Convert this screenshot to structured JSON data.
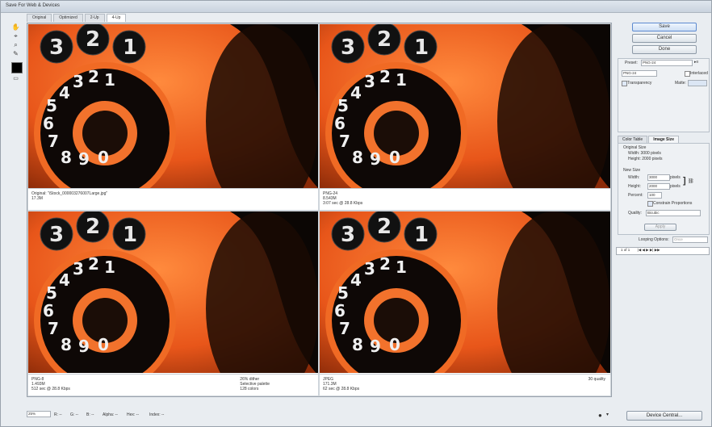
{
  "window": {
    "title": "Save For Web & Devices"
  },
  "tabs": [
    "Original",
    "Optimized",
    "2-Up",
    "4-Up"
  ],
  "active_tab": "4-Up",
  "tools": [
    {
      "name": "hand-tool-icon",
      "glyph": "✋"
    },
    {
      "name": "slice-select-tool-icon",
      "glyph": "⌖"
    },
    {
      "name": "zoom-tool-icon",
      "glyph": "⌕"
    },
    {
      "name": "eyedropper-tool-icon",
      "glyph": "✎"
    }
  ],
  "eyedropper_color": "#000000",
  "panes": [
    {
      "lines_left": [
        "Original: \"iStock_000003276007Large.jpg\"",
        "17.3M"
      ],
      "lines_right": [],
      "lines_right2": []
    },
    {
      "lines_left": [
        "PNG-24",
        "8.543M",
        "3:07 sec @ 28.8 Kbps"
      ],
      "lines_right": [],
      "lines_right2": []
    },
    {
      "lines_left": [
        "PNG-8",
        "1.493M",
        "512 sec @ 28.8 Kbps"
      ],
      "lines_right2": [
        "26% dither",
        "Selective palette",
        "128 colors"
      ],
      "lines_right": []
    },
    {
      "lines_left": [
        "JPEG",
        "171.3M",
        "62 sec @ 28.8 Kbps"
      ],
      "lines_right": [
        "30 quality"
      ],
      "lines_right2": []
    }
  ],
  "buttons": {
    "save": "Save",
    "cancel": "Cancel",
    "done": "Done"
  },
  "preset": {
    "label": "Preset:",
    "value": "PNG-24"
  },
  "format": {
    "value": "PNG-24",
    "interlaced": "Interlaced",
    "transparency": "Transparency",
    "matte": "Matte:"
  },
  "subtabs": [
    "Color Table",
    "Image Size"
  ],
  "image_size": {
    "original_label": "Original Size",
    "orig_width": "Width: 3000 pixels",
    "orig_height": "Height: 2000 pixels",
    "new_label": "New Size",
    "width_label": "Width:",
    "width_value": "3000",
    "width_unit": "pixels",
    "height_label": "Height:",
    "height_value": "2000",
    "height_unit": "pixels",
    "percent_label": "Percent:",
    "percent_value": "100",
    "constrain": "Constrain Proportions",
    "quality_label": "Quality:",
    "quality_value": "Bicubic",
    "apply": "Apply"
  },
  "looping": {
    "label": "Looping Options:",
    "value": "Once"
  },
  "animation": {
    "frame": "1 of 1"
  },
  "status": {
    "zoom": "25%",
    "items": [
      "R: --",
      "G: --",
      "B: --",
      "Alpha: --",
      "Hex: --",
      "Index: --"
    ]
  },
  "device_central": "Device Central..."
}
